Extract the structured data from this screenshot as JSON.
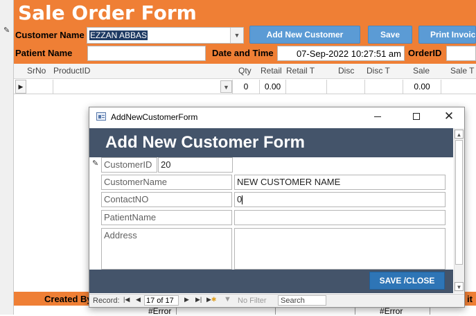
{
  "form": {
    "title": "Sale Order Form",
    "customer_label": "Customer Name",
    "customer_value": "EZZAN ABBAS",
    "patient_label": "Patient Name",
    "patient_value": "",
    "datetime_label": "Date and Time",
    "datetime_value": "07-Sep-2022 10:27:51 am",
    "orderid_label": "OrderID",
    "orderid_value": "",
    "buttons": {
      "add_customer": "Add New Customer",
      "save": "Save",
      "print": "Print Invoice"
    }
  },
  "grid": {
    "headers": [
      "SrNo",
      "ProductID",
      "Qty",
      "Retail",
      "Retail T",
      "Disc",
      "Disc T",
      "Sale",
      "Sale T"
    ],
    "row": {
      "qty": "0",
      "retail": "0.00",
      "sale": "0.00"
    }
  },
  "footer": {
    "created_by": "Created By",
    "errors": [
      "#Error",
      "#Error"
    ],
    "edge_text": "it"
  },
  "dialog": {
    "window_title": "AddNewCustomerForm",
    "heading": "Add New Customer Form",
    "fields": {
      "customer_id_label": "CustomerID",
      "customer_id_value": "20",
      "customer_name_label": "CustomerName",
      "customer_name_value": "NEW CUSTOMER NAME",
      "contact_label": "ContactNO",
      "contact_value": "0",
      "patient_label": "PatientName",
      "patient_value": "",
      "address_label": "Address",
      "address_value": ""
    },
    "save_close": "SAVE /CLOSE",
    "nav": {
      "record_label": "Record:",
      "position": "17 of 17",
      "filter": "No Filter",
      "search_placeholder": "Search"
    }
  },
  "colors": {
    "header": "#ef7f35",
    "button": "#5b9bd5",
    "dialog_band": "#44546a",
    "dialog_button": "#2e75b6"
  }
}
